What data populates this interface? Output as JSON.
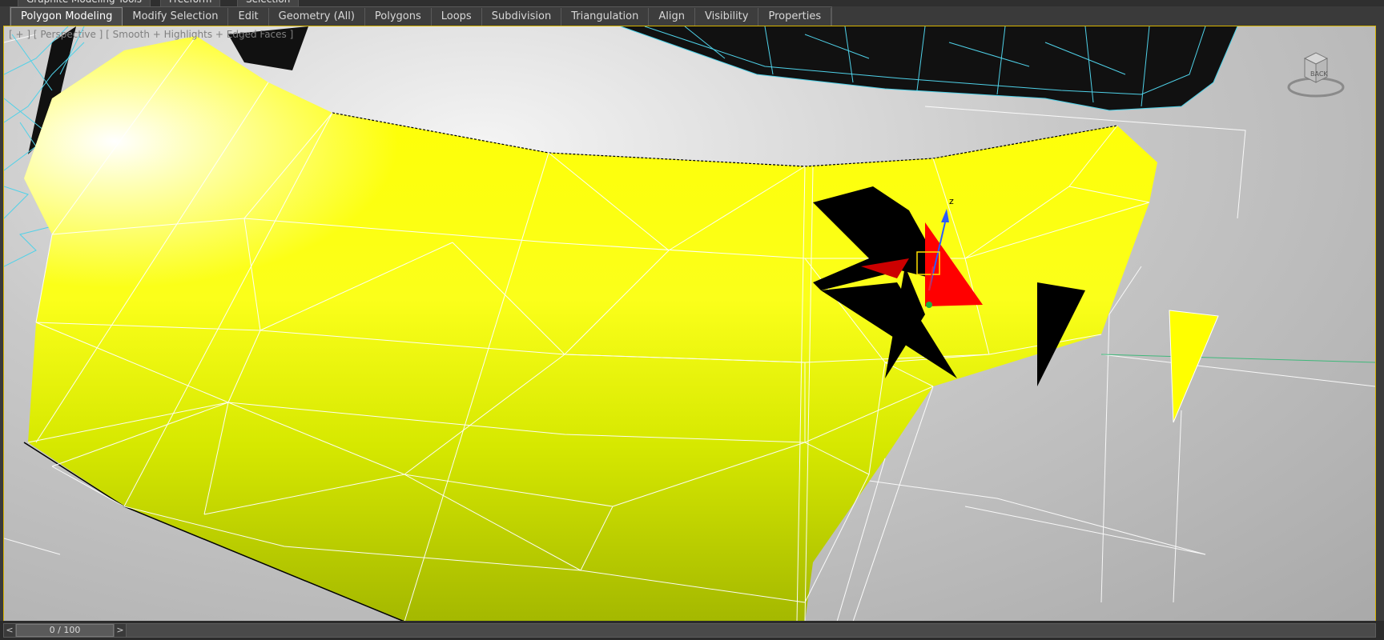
{
  "top_tabs": [
    "Graphite Modeling Tools",
    "Freeform",
    "Selection"
  ],
  "ribbon_tabs": [
    "Polygon Modeling",
    "Modify Selection",
    "Edit",
    "Geometry (All)",
    "Polygons",
    "Loops",
    "Subdivision",
    "Triangulation",
    "Align",
    "Visibility",
    "Properties"
  ],
  "viewport": {
    "label": "[ + ] [ Perspective ] [ Smooth + Highlights + Edged Faces ]",
    "viewcube_face": "BACK",
    "gizmo_axis": "z"
  },
  "timeline": {
    "frame": "0 / 100",
    "prev": "<",
    "next": ">"
  },
  "colors": {
    "mesh_yellow": "#ffff00",
    "selected_face": "#ff0000",
    "wire_cyan": "#4fd1e8",
    "viewport_border": "#d7b400"
  }
}
